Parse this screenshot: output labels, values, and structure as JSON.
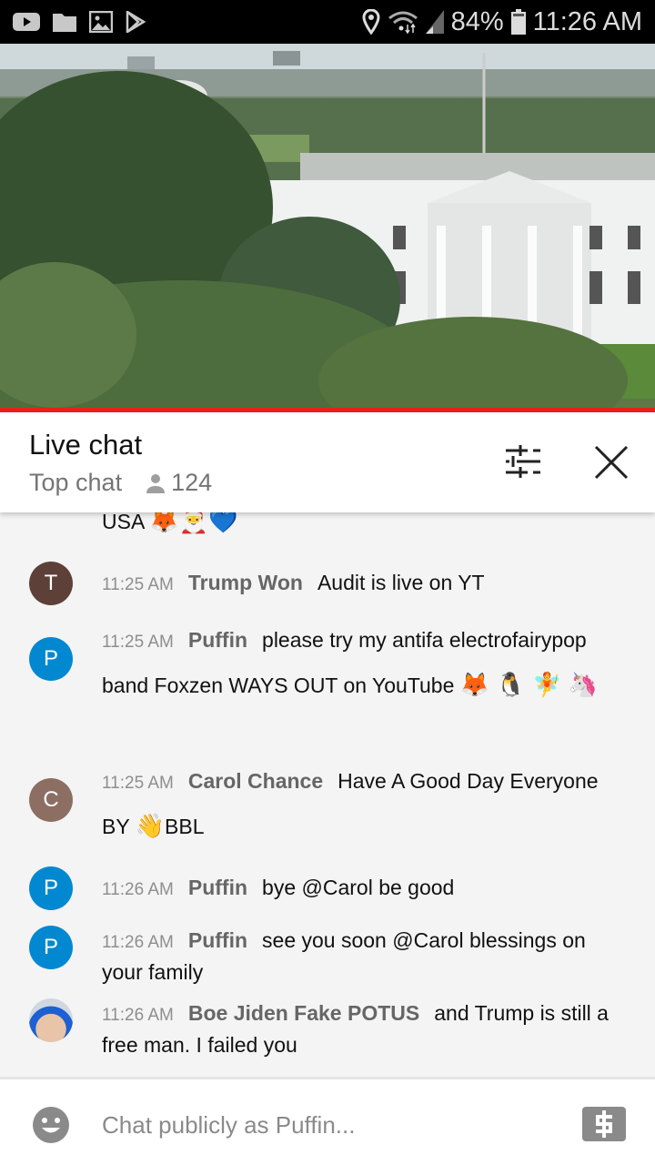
{
  "status_bar": {
    "battery": "84%",
    "time": "11:26 AM",
    "left_icons": [
      "youtube-icon",
      "folder-icon",
      "gallery-icon",
      "play-store-icon"
    ],
    "right_icons": [
      "location-icon",
      "wifi-icon",
      "signal-icon",
      "battery-icon"
    ]
  },
  "video": {
    "description": "White House live stream",
    "progress_percent": 100
  },
  "header": {
    "title": "Live chat",
    "mode": "Top chat",
    "viewer_count": "124"
  },
  "chat": {
    "partial_top": {
      "text": "USA",
      "emojis": "🦊🎅💙"
    },
    "messages": [
      {
        "avatar_letter": "T",
        "avatar_color": "#5d4037",
        "time": "11:25 AM",
        "author": "Trump Won",
        "text": "Audit is live on YT",
        "emojis": ""
      },
      {
        "avatar_letter": "P",
        "avatar_color": "#0288d1",
        "time": "11:25 AM",
        "author": "Puffin",
        "text": "please try my antifa electrofairypop band Foxzen WAYS OUT on YouTube",
        "emojis": "🦊 🐧 🧚 🦄"
      },
      {
        "avatar_letter": "C",
        "avatar_color": "#8d6e63",
        "time": "11:25 AM",
        "author": "Carol Chance",
        "text": "Have A Good Day Everyone BY",
        "emoji_inline": "👋",
        "text_after": "BBL"
      },
      {
        "avatar_letter": "P",
        "avatar_color": "#0288d1",
        "time": "11:26 AM",
        "author": "Puffin",
        "text": "bye @Carol be good"
      },
      {
        "avatar_letter": "P",
        "avatar_color": "#0288d1",
        "time": "11:26 AM",
        "author": "Puffin",
        "text": "see you soon @Carol blessings on your family"
      },
      {
        "avatar_letter": "",
        "avatar_color": "#4a6fa5",
        "time": "11:26 AM",
        "author": "Boe Jiden Fake POTUS",
        "text": "and Trump is still a free man. I failed you"
      }
    ]
  },
  "footer": {
    "placeholder": "Chat publicly as Puffin..."
  },
  "colors": {
    "accent_red": "#e62117",
    "chat_bg": "#f4f4f4"
  }
}
